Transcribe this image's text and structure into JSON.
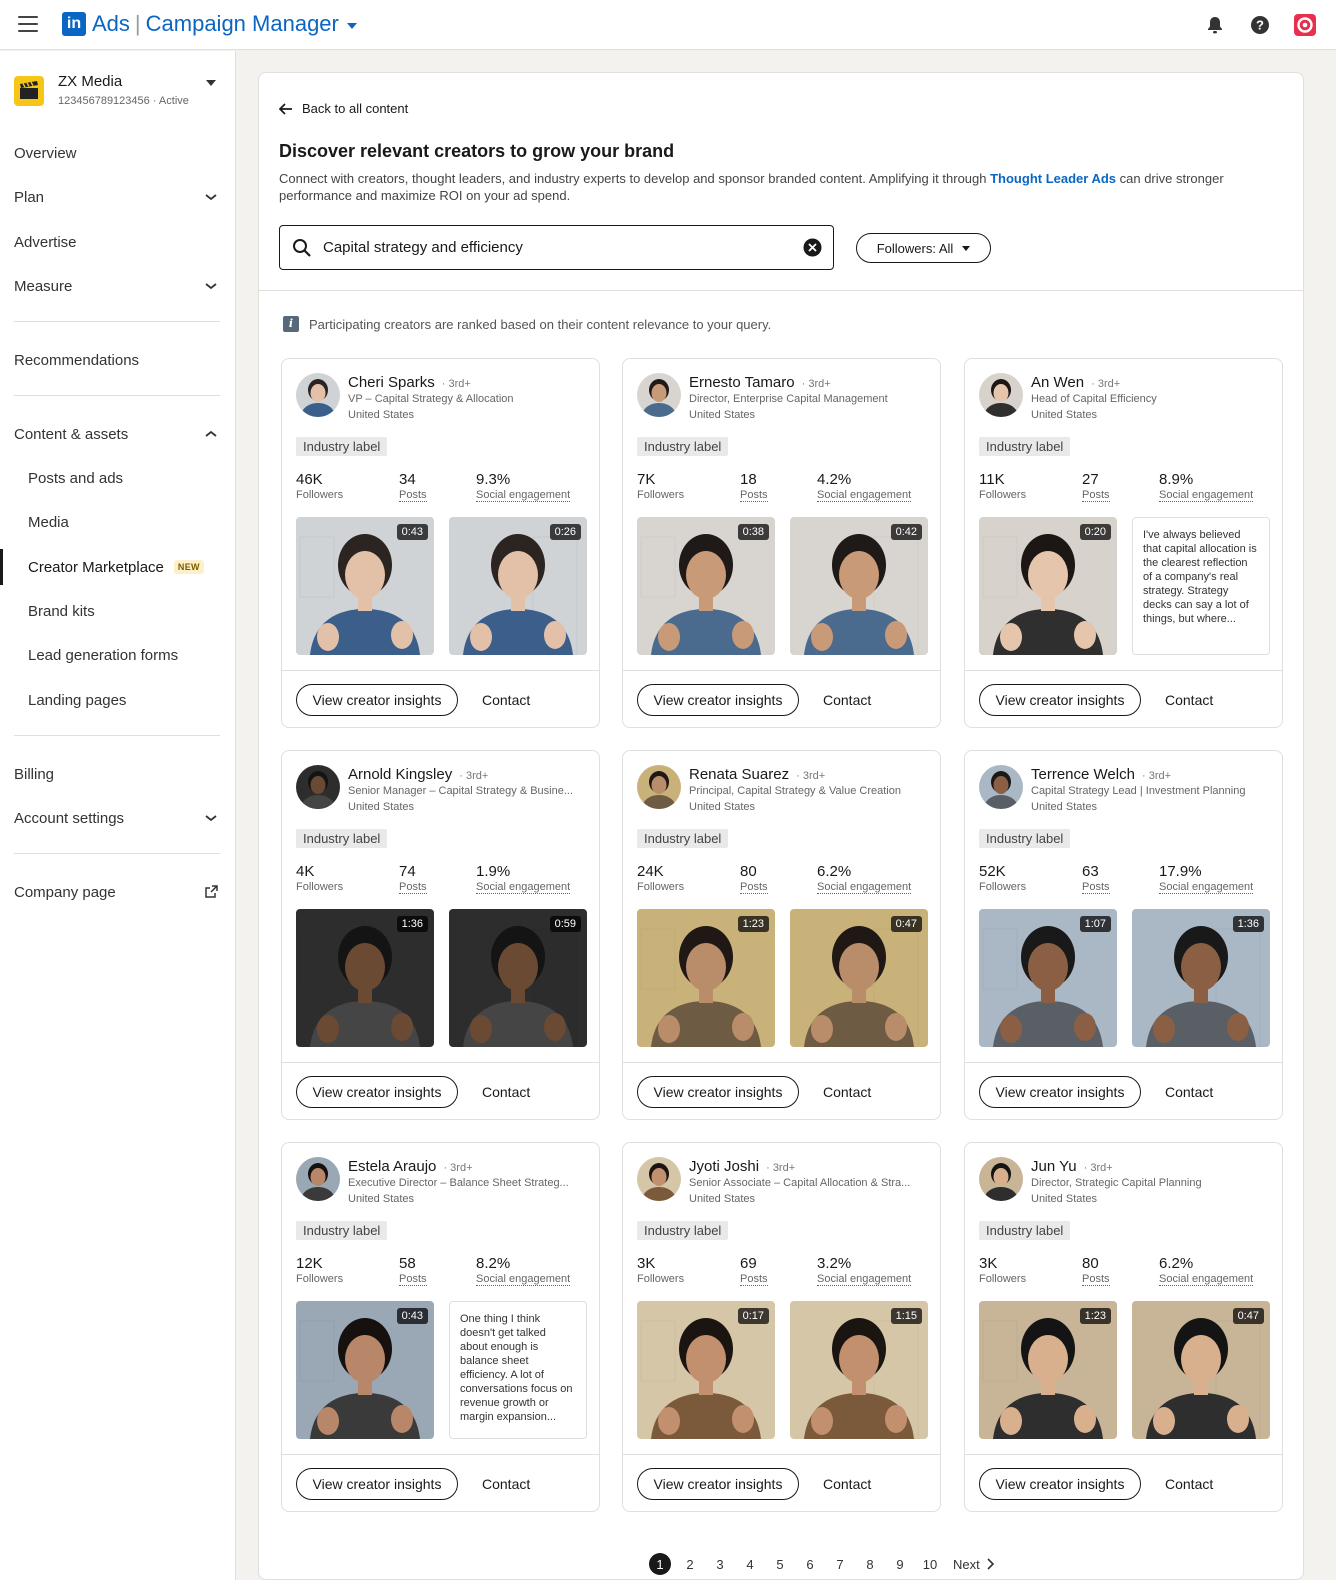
{
  "topbar": {
    "logo": "in",
    "product": "Ads",
    "app_name": "Campaign Manager",
    "icons": [
      "bell-icon",
      "help-icon",
      "profile-icon"
    ]
  },
  "account": {
    "name": "ZX Media",
    "id_status": "123456789123456 · Active"
  },
  "sidebar": {
    "overview": "Overview",
    "plan": "Plan",
    "advertise": "Advertise",
    "measure": "Measure",
    "recommendations": "Recommendations",
    "content_assets": "Content & assets",
    "posts_ads": "Posts and ads",
    "media": "Media",
    "creator_marketplace": "Creator Marketplace",
    "new_badge": "NEW",
    "brand_kits": "Brand kits",
    "lead_gen": "Lead generation forms",
    "landing_pages": "Landing pages",
    "billing": "Billing",
    "account_settings": "Account settings",
    "company_page": "Company page"
  },
  "main": {
    "back": "Back to all content",
    "title": "Discover relevant creators to grow your brand",
    "desc_before": "Connect with creators, thought leaders, and industry experts to develop and sponsor branded content. Amplifying it through ",
    "desc_link": "Thought Leader Ads",
    "desc_after": " can drive stronger performance and maximize ROI on your ad spend.",
    "search_value": "Capital strategy and efficiency",
    "followers_filter": "Followers: All",
    "info": "Participating creators are ranked based on their content relevance to your query."
  },
  "labels": {
    "followers": "Followers",
    "posts": "Posts",
    "engagement": "Social engagement",
    "industry": "Industry label",
    "view_insights": "View creator insights",
    "contact": "Contact"
  },
  "creators": [
    {
      "name": "Cheri Sparks",
      "degree": "3rd+",
      "title": "VP – Capital Strategy & Allocation",
      "location": "United States",
      "followers": "46K",
      "posts": "34",
      "engagement": "9.3%",
      "d1": "0:43",
      "d2": "0:26",
      "quote": ""
    },
    {
      "name": "Ernesto Tamaro",
      "degree": "3rd+",
      "title": "Director, Enterprise Capital Management",
      "location": "United States",
      "followers": "7K",
      "posts": "18",
      "engagement": "4.2%",
      "d1": "0:38",
      "d2": "0:42",
      "quote": ""
    },
    {
      "name": "An Wen",
      "degree": "3rd+",
      "title": "Head of Capital Efficiency",
      "location": "United States",
      "followers": "11K",
      "posts": "27",
      "engagement": "8.9%",
      "d1": "0:20",
      "d2": "",
      "quote": "I've always believed that capital allocation is the clearest reflection of a company's real strategy. Strategy decks can say a lot of things, but where..."
    },
    {
      "name": "Arnold Kingsley",
      "degree": "3rd+",
      "title": "Senior Manager – Capital Strategy & Busine...",
      "location": "United States",
      "followers": "4K",
      "posts": "74",
      "engagement": "1.9%",
      "d1": "1:36",
      "d2": "0:59",
      "quote": ""
    },
    {
      "name": "Renata Suarez",
      "degree": "3rd+",
      "title": "Principal, Capital Strategy & Value Creation",
      "location": "United States",
      "followers": "24K",
      "posts": "80",
      "engagement": "6.2%",
      "d1": "1:23",
      "d2": "0:47",
      "quote": ""
    },
    {
      "name": "Terrence Welch",
      "degree": "3rd+",
      "title": "Capital Strategy Lead | Investment Planning",
      "location": "United States",
      "followers": "52K",
      "posts": "63",
      "engagement": "17.9%",
      "d1": "1:07",
      "d2": "1:36",
      "quote": ""
    },
    {
      "name": "Estela Araujo",
      "degree": "3rd+",
      "title": "Executive Director – Balance Sheet Strateg...",
      "location": "United States",
      "followers": "12K",
      "posts": "58",
      "engagement": "8.2%",
      "d1": "0:43",
      "d2": "",
      "quote": "One thing I think doesn't get talked about enough is balance sheet efficiency. A lot of conversations focus on revenue growth or margin expansion..."
    },
    {
      "name": "Jyoti Joshi",
      "degree": "3rd+",
      "title": "Senior Associate – Capital Allocation & Stra...",
      "location": "United States",
      "followers": "3K",
      "posts": "69",
      "engagement": "3.2%",
      "d1": "0:17",
      "d2": "1:15",
      "quote": ""
    },
    {
      "name": "Jun Yu",
      "degree": "3rd+",
      "title": "Director, Strategic Capital Planning",
      "location": "United States",
      "followers": "3K",
      "posts": "80",
      "engagement": "6.2%",
      "d1": "1:23",
      "d2": "0:47",
      "quote": ""
    }
  ],
  "pagination": {
    "pages": [
      "1",
      "2",
      "3",
      "4",
      "5",
      "6",
      "7",
      "8",
      "9",
      "10"
    ],
    "current": "1",
    "next": "Next"
  }
}
